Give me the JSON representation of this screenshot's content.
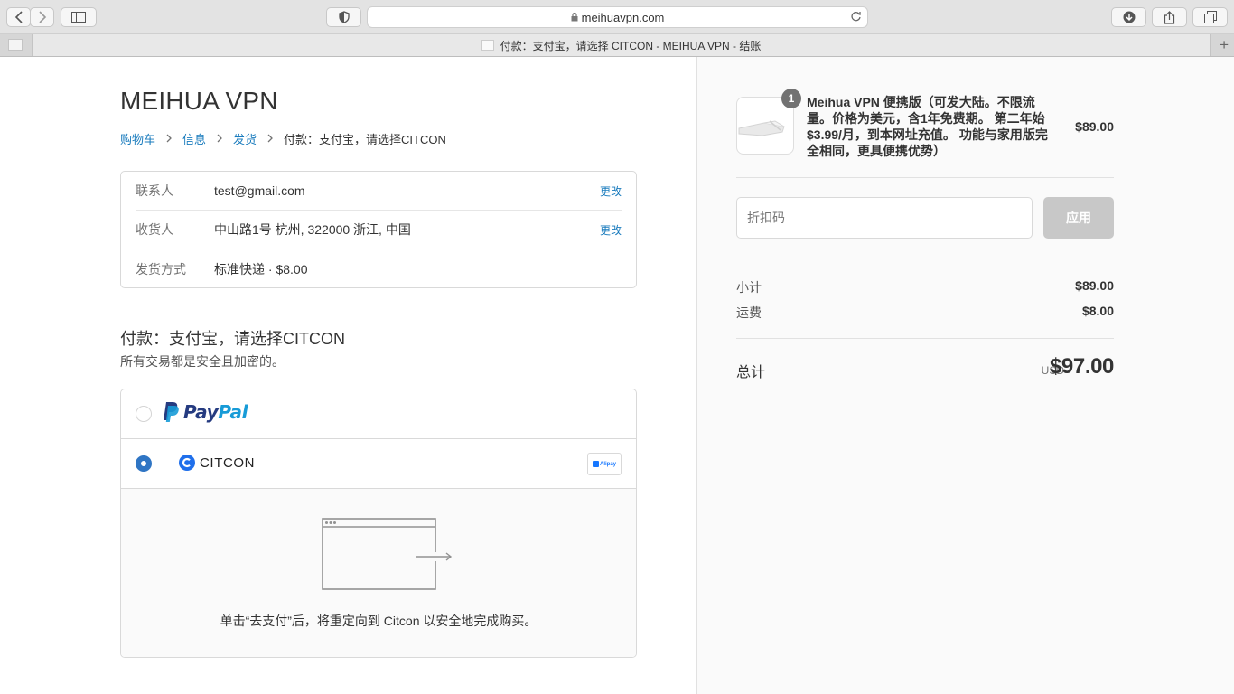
{
  "browser": {
    "url": "meihuavpn.com",
    "tab_title": "付款：支付宝，请选择 CITCON - MEIHUA VPN - 结账"
  },
  "store_name": "MEIHUA VPN",
  "breadcrumbs": [
    "购物车",
    "信息",
    "发货",
    "付款：支付宝，请选择CITCON"
  ],
  "review": [
    {
      "label": "联系人",
      "value": "test@gmail.com",
      "action": "更改"
    },
    {
      "label": "收货人",
      "value": "中山路1号 杭州, 322000 浙江, 中国",
      "action": "更改"
    },
    {
      "label": "发货方式",
      "value": "标准快递 · $8.00"
    }
  ],
  "payment": {
    "title": "付款：支付宝，请选择CITCON",
    "subtitle": "所有交易都是安全且加密的。",
    "methods": [
      {
        "name": "PayPal",
        "logo_parts": [
          "Pay",
          "Pal"
        ],
        "selected": false
      },
      {
        "name": "CITCON",
        "badge": "Alipay",
        "selected": true
      }
    ],
    "redirect_text": "单击“去支付”后，将重定向到 Citcon 以安全地完成购买。"
  },
  "summary": {
    "product": {
      "quantity": "1",
      "name": "Meihua VPN 便携版（可发大陆。不限流量。价格为美元，含1年免费期。 第二年始$3.99/月，到本网址充值。 功能与家用版完全相同，更具便携优势）",
      "price": "$89.00"
    },
    "discount_placeholder": "折扣码",
    "apply_label": "应用",
    "subtotal_label": "小计",
    "subtotal": "$89.00",
    "shipping_label": "运费",
    "shipping": "$8.00",
    "total_label": "总计",
    "currency": "USD",
    "total": "$97.00"
  },
  "colors": {
    "link": "#197bbd",
    "radio_selected": "#2f75c4",
    "paypal_dark": "#253b80",
    "paypal_light": "#179bd7",
    "citcon_blue": "#1f6feb"
  }
}
